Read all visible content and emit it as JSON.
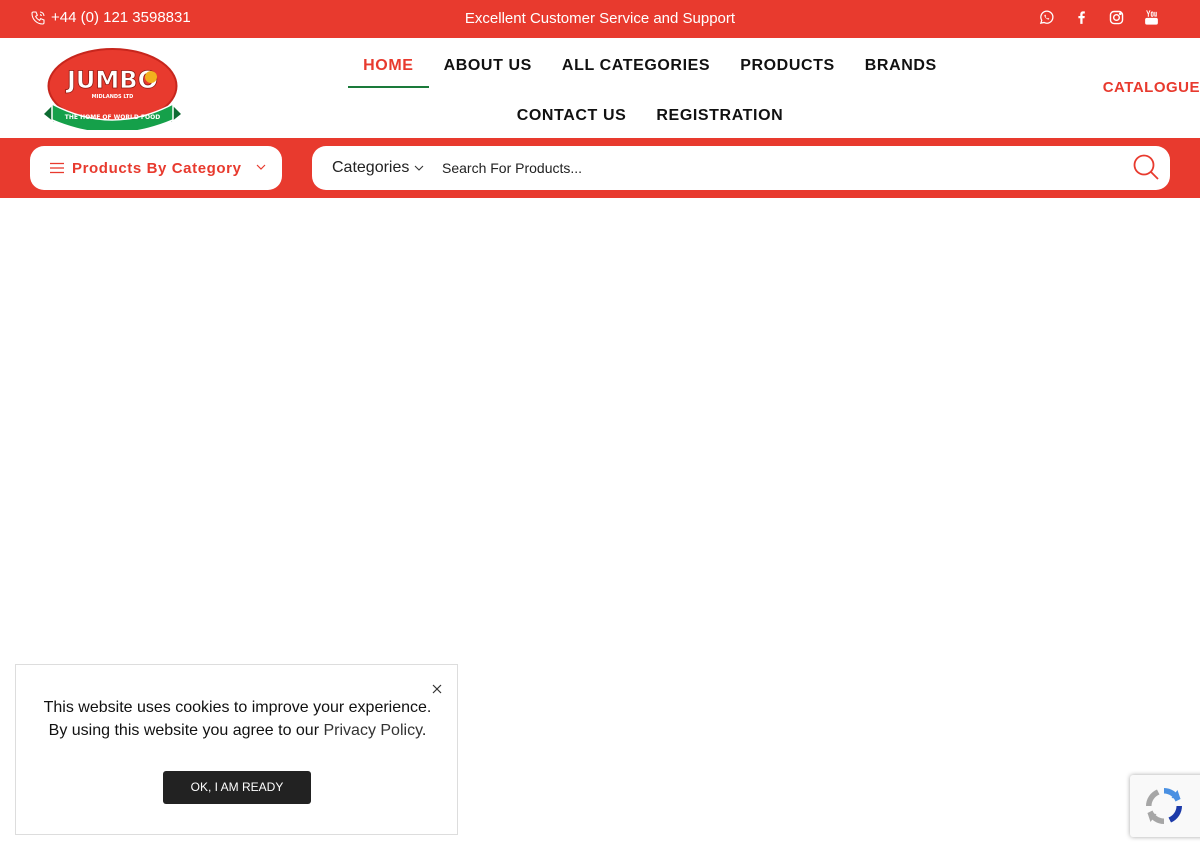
{
  "topbar": {
    "phone": "+44 (0) 121 3598831",
    "tagline": "Excellent Customer Service and Support",
    "socials": [
      "whatsapp-icon",
      "facebook-icon",
      "instagram-icon",
      "youtube-icon"
    ]
  },
  "header": {
    "logo": {
      "text": "JUMBO",
      "subtext": "MIDLANDS LTD",
      "ribbon": "THE HOME OF WORLD FOOD"
    },
    "nav": [
      {
        "label": "HOME",
        "active": true
      },
      {
        "label": "ABOUT US",
        "active": false
      },
      {
        "label": "ALL CATEGORIES",
        "active": false
      },
      {
        "label": "PRODUCTS",
        "active": false
      },
      {
        "label": "BRANDS",
        "active": false
      },
      {
        "label": "CONTACT US",
        "active": false
      },
      {
        "label": "REGISTRATION",
        "active": false
      }
    ],
    "catalogue": "CATALOGUE"
  },
  "search": {
    "category_button": "Products By Category",
    "category_select": "Categories",
    "placeholder": "Search For Products..."
  },
  "cookie": {
    "line1": "This website uses cookies to improve your experience.",
    "line2_prefix": "By using this website you agree to our ",
    "link": "Privacy Policy",
    "line2_suffix": ".",
    "button": "OK, I AM READY"
  },
  "colors": {
    "brand_red": "#e83a2e",
    "brand_green": "#1a7a3a",
    "button_dark": "#222222"
  }
}
